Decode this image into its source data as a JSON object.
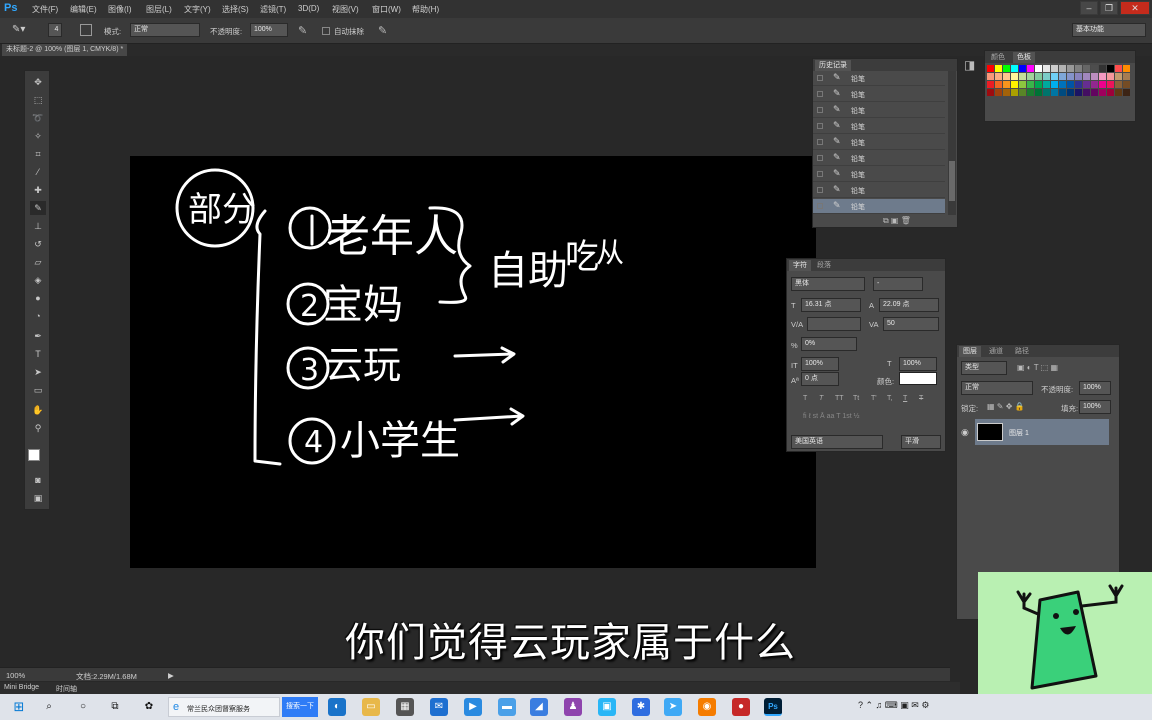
{
  "app": {
    "logo": "Ps"
  },
  "menu": [
    "文件(F)",
    "编辑(E)",
    "图像(I)",
    "图层(L)",
    "文字(Y)",
    "选择(S)",
    "滤镜(T)",
    "3D(D)",
    "视图(V)",
    "窗口(W)",
    "帮助(H)"
  ],
  "window_controls": {
    "minimize": "–",
    "restore": "❐",
    "close": "✕"
  },
  "options": {
    "brush_size": "4",
    "mode_label": "模式:",
    "mode_value": "正常",
    "opacity_label": "不透明度:",
    "opacity_value": "100%",
    "auto_erase_label": "自动抹除",
    "workspace": "基本功能"
  },
  "document_tab": "未标题-2 @ 100% (图层 1, CMYK/8) *",
  "history_panel": {
    "tab": "历史记录",
    "items": [
      "铅笔",
      "铅笔",
      "铅笔",
      "铅笔",
      "铅笔",
      "铅笔",
      "铅笔",
      "铅笔",
      "铅笔"
    ]
  },
  "swatches_panel": {
    "tabs": [
      "颜色",
      "色板"
    ]
  },
  "character_panel": {
    "tabs": [
      "字符",
      "段落"
    ],
    "font": "黑体",
    "style": "-",
    "size": "16.31 点",
    "leading": "22.09 点",
    "kerning": "",
    "tracking": "50",
    "scale_pct": "0%",
    "vscale": "100%",
    "hscale": "100%",
    "baseline": "0 点",
    "color_label": "颜色:",
    "language": "美国英语",
    "aa": "平滑",
    "style_buttons": [
      "T",
      "T",
      "TT",
      "Tt",
      "T'",
      "T,",
      "T",
      "T"
    ]
  },
  "layers_panel": {
    "tabs": [
      "图层",
      "通道",
      "路径"
    ],
    "filter": "类型",
    "blend": "正常",
    "opacity_label": "不透明度:",
    "opacity": "100%",
    "lock_label": "锁定:",
    "fill_label": "填充:",
    "fill": "100%",
    "layers": [
      {
        "name": "图层 1"
      }
    ]
  },
  "status": {
    "zoom": "100%",
    "doc": "文档:2.29M/1.68M"
  },
  "mini_bridge": {
    "tabs": [
      "Mini Bridge",
      "时间轴"
    ]
  },
  "taskbar": {
    "browser_title": "常兰民众团督察服务",
    "search_btn": "搜索一下"
  },
  "subtitle": "你们觉得云玩家属于什么",
  "colors": {
    "ps_bg": "#282828",
    "panel": "#4a4a4a",
    "canvas": "#000000",
    "accent": "#31a8ff",
    "mascot_bg": "#b9f0b2",
    "mascot_body": "#3ad07a"
  }
}
